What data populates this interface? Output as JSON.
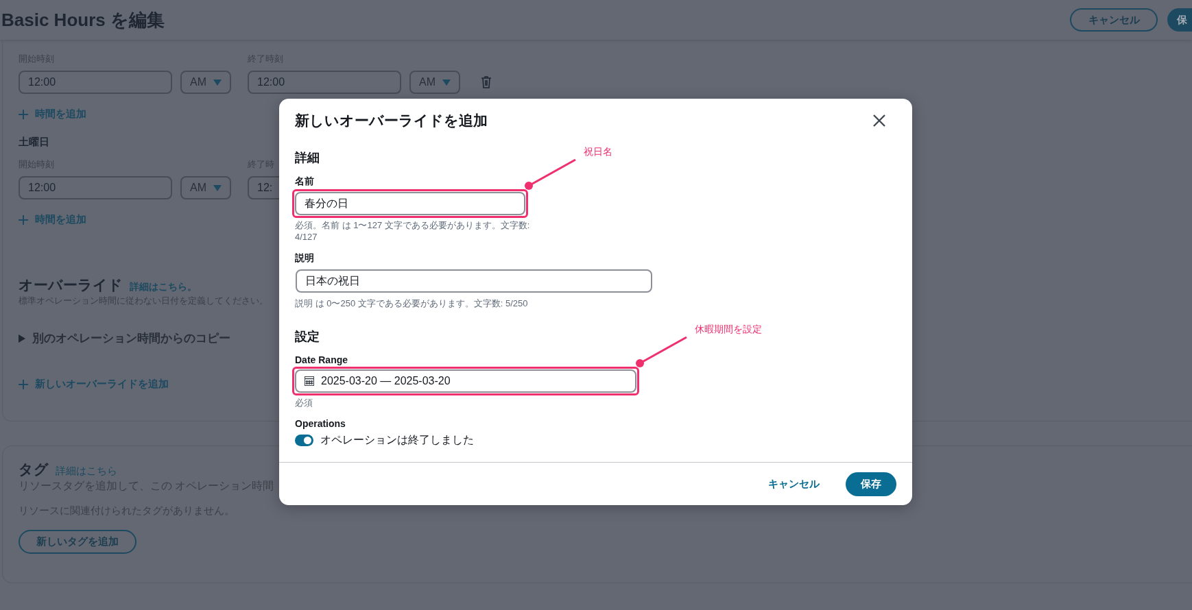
{
  "page": {
    "title": "Basic Hours を編集",
    "actions": [
      {
        "label": "キャンセル",
        "kind": "secondary"
      },
      {
        "label": "保",
        "kind": "primary"
      }
    ]
  },
  "schedule": [
    {
      "rows": [
        {
          "start_label": "開始時刻",
          "start": "12:00",
          "start_period": "AM",
          "end_label": "終了時刻",
          "end": "12:00",
          "end_period": "AM",
          "deletable": true
        }
      ],
      "add_label": "時間を追加"
    },
    {
      "name": "土曜日",
      "rows": [
        {
          "start_label": "開始時刻",
          "start": "12:00",
          "start_period": "AM",
          "end_label": "終了時",
          "end": "12:"
        }
      ],
      "add_label": "時間を追加"
    }
  ],
  "overrides": {
    "title": "オーバーライド",
    "link": "詳細はこちら。",
    "description": "標準オペレーション時間に従わない日付を定義してください。",
    "copy": {
      "label": "別のオペレーション時間からのコピー",
      "expanded": false
    },
    "add_label": "新しいオーバーライドを追加"
  },
  "tags": {
    "title": "タグ",
    "link": "詳細はこちら",
    "description": "リソースタグを追加して、この オペレーション時間",
    "empty": "リソースに関連付けられたタグがありません。",
    "add_button": "新しいタグを追加"
  },
  "dialog": {
    "title": "新しいオーバーライドを追加",
    "details_heading": "詳細",
    "name": {
      "label": "名前",
      "value": "春分の日",
      "help": "必須。名前 は 1〜127 文字である必要があります。文字数: 4/127",
      "highlighted": true,
      "callout": "祝日名"
    },
    "description": {
      "label": "説明",
      "value": "日本の祝日",
      "help": "説明 は 0〜250 文字である必要があります。文字数: 5/250"
    },
    "settings_heading": "設定",
    "date_range": {
      "label": "Date Range",
      "value": "2025-03-20 — 2025-03-20",
      "help": "必須",
      "highlighted": true,
      "callout": "休暇期間を設定"
    },
    "operations": {
      "label": "Operations",
      "toggle_label": "オペレーションは終了しました",
      "on": true
    },
    "buttons": [
      {
        "label": "キャンセル",
        "kind": "link"
      },
      {
        "label": "保存",
        "kind": "primary"
      }
    ]
  }
}
